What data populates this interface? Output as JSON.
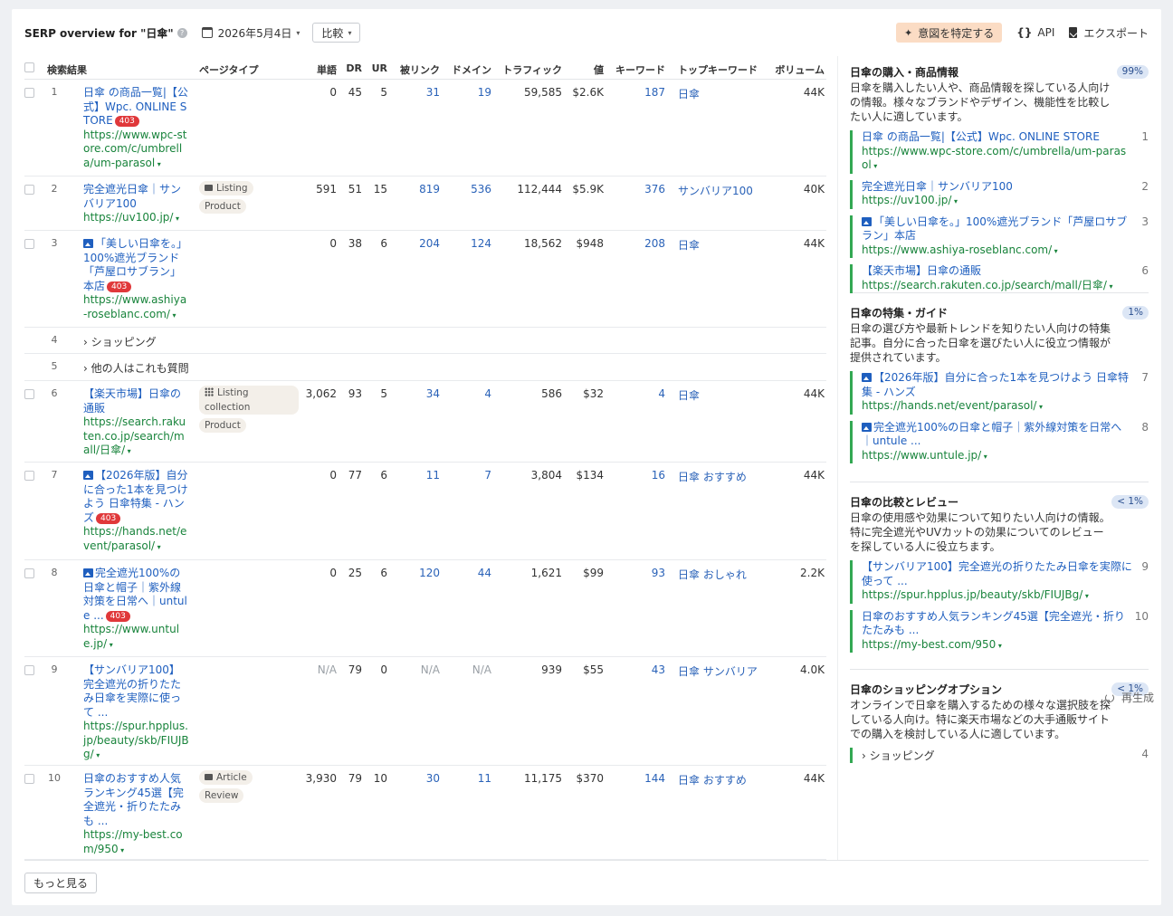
{
  "header": {
    "title": "SERP overview for \"日傘\"",
    "help": "?",
    "date": "2026年5月4日",
    "compare": "比較",
    "intent_button": "意図を特定する",
    "api": "API",
    "export": "エクスポート"
  },
  "columns": {
    "result": "検索結果",
    "page_type": "ページタイプ",
    "words": "単語",
    "dr": "DR",
    "ur": "UR",
    "backlinks": "被リンク",
    "domains": "ドメイン",
    "traffic": "トラフィック",
    "value": "値",
    "keywords": "キーワード",
    "top_keyword": "トップキーワード",
    "volume": "ボリューム"
  },
  "rows": [
    {
      "rank": "1",
      "title": "日傘 の商品一覧|【公式】Wpc. ONLINE STORE",
      "badge": "403",
      "img": false,
      "url": "https://www.wpc-store.com/c/umbrella/um-parasol",
      "tags": [],
      "words": "0",
      "dr": "45",
      "ur": "5",
      "backlinks": "31",
      "domains": "19",
      "traffic": "59,585",
      "value": "$2.6K",
      "keywords": "187",
      "top_keyword": "日傘",
      "volume": "44K"
    },
    {
      "rank": "2",
      "title": "完全遮光日傘｜サンバリア100",
      "badge": "",
      "img": false,
      "url": "https://uv100.jp/",
      "tags": [
        "Listing",
        "Product"
      ],
      "tag_icon": "label",
      "words": "591",
      "dr": "51",
      "ur": "15",
      "backlinks": "819",
      "domains": "536",
      "traffic": "112,444",
      "value": "$5.9K",
      "keywords": "376",
      "top_keyword": "サンバリア100",
      "volume": "40K"
    },
    {
      "rank": "3",
      "title": "「美しい日傘を。」100%遮光ブランド「芦屋ロサブラン」本店",
      "badge": "403",
      "img": true,
      "url": "https://www.ashiya-roseblanc.com/",
      "tags": [],
      "words": "0",
      "dr": "38",
      "ur": "6",
      "backlinks": "204",
      "domains": "124",
      "traffic": "18,562",
      "value": "$948",
      "keywords": "208",
      "top_keyword": "日傘",
      "volume": "44K"
    },
    {
      "rank": "4",
      "expand": "ショッピング"
    },
    {
      "rank": "5",
      "expand": "他の人はこれも質問"
    },
    {
      "rank": "6",
      "title": "【楽天市場】日傘の通販",
      "badge": "",
      "img": false,
      "url": "https://search.rakuten.co.jp/search/mall/日傘/",
      "tags": [
        "Listing collection",
        "Product"
      ],
      "tag_icon": "grid",
      "words": "3,062",
      "dr": "93",
      "ur": "5",
      "backlinks": "34",
      "domains": "4",
      "traffic": "586",
      "value": "$32",
      "keywords": "4",
      "top_keyword": "日傘",
      "volume": "44K"
    },
    {
      "rank": "7",
      "title": "【2026年版】自分に合った1本を見つけよう 日傘特集 - ハンズ",
      "badge": "403",
      "img": true,
      "url": "https://hands.net/event/parasol/",
      "tags": [],
      "words": "0",
      "dr": "77",
      "ur": "6",
      "backlinks": "11",
      "domains": "7",
      "traffic": "3,804",
      "value": "$134",
      "keywords": "16",
      "top_keyword": "日傘 おすすめ",
      "volume": "44K"
    },
    {
      "rank": "8",
      "title": "完全遮光100%の日傘と帽子｜紫外線対策を日常へ｜untule ...",
      "badge": "403",
      "img": true,
      "url": "https://www.untule.jp/",
      "tags": [],
      "words": "0",
      "dr": "25",
      "ur": "6",
      "backlinks": "120",
      "domains": "44",
      "traffic": "1,621",
      "value": "$99",
      "keywords": "93",
      "top_keyword": "日傘 おしゃれ",
      "volume": "2.2K"
    },
    {
      "rank": "9",
      "title": "【サンバリア100】完全遮光の折りたたみ日傘を実際に使って ...",
      "badge": "",
      "img": false,
      "url": "https://spur.hpplus.jp/beauty/skb/FIUJBg/",
      "tags": [],
      "words": "N/A",
      "dr": "79",
      "ur": "0",
      "backlinks": "N/A",
      "domains": "N/A",
      "traffic": "939",
      "value": "$55",
      "keywords": "43",
      "top_keyword": "日傘 サンバリア",
      "volume": "4.0K"
    },
    {
      "rank": "10",
      "title": "日傘のおすすめ人気ランキング45選【完全遮光・折りたたみも ...",
      "badge": "",
      "img": false,
      "url": "https://my-best.com/950",
      "tags": [
        "Article",
        "Review"
      ],
      "tag_icon": "article",
      "words": "3,930",
      "dr": "79",
      "ur": "10",
      "backlinks": "30",
      "domains": "11",
      "traffic": "11,175",
      "value": "$370",
      "keywords": "144",
      "top_keyword": "日傘 おすすめ",
      "volume": "44K"
    }
  ],
  "more_button": "もっと見る",
  "intents": [
    {
      "title": "日傘の購入・商品情報",
      "pct": "99%",
      "desc": "日傘を購入したい人や、商品情報を探している人向けの情報。様々なブランドやデザイン、機能性を比較したい人に適しています。",
      "items": [
        {
          "title": "日傘 の商品一覧|【公式】Wpc. ONLINE STORE",
          "url": "https://www.wpc-store.com/c/umbrella/um-parasol",
          "pos": "1",
          "img": false
        },
        {
          "title": "完全遮光日傘｜サンバリア100",
          "url": "https://uv100.jp/",
          "pos": "2",
          "img": false
        },
        {
          "title": "「美しい日傘を。」100%遮光ブランド「芦屋ロサブラン」本店",
          "url": "https://www.ashiya-roseblanc.com/",
          "pos": "3",
          "img": true
        },
        {
          "title": "【楽天市場】日傘の通販",
          "url": "https://search.rakuten.co.jp/search/mall/日傘/",
          "pos": "6",
          "img": false
        }
      ]
    },
    {
      "title": "日傘の特集・ガイド",
      "pct": "1%",
      "desc": "日傘の選び方や最新トレンドを知りたい人向けの特集記事。自分に合った日傘を選びたい人に役立つ情報が提供されています。",
      "items": [
        {
          "title": "【2026年版】自分に合った1本を見つけよう 日傘特集 - ハンズ",
          "url": "https://hands.net/event/parasol/",
          "pos": "7",
          "img": true
        },
        {
          "title": "完全遮光100%の日傘と帽子｜紫外線対策を日常へ｜untule ...",
          "url": "https://www.untule.jp/",
          "pos": "8",
          "img": true
        }
      ]
    },
    {
      "title": "日傘の比較とレビュー",
      "pct": "< 1%",
      "desc": "日傘の使用感や効果について知りたい人向けの情報。特に完全遮光やUVカットの効果についてのレビューを探している人に役立ちます。",
      "items": [
        {
          "title": "【サンバリア100】完全遮光の折りたたみ日傘を実際に使って ...",
          "url": "https://spur.hpplus.jp/beauty/skb/FIUJBg/",
          "pos": "9",
          "img": false
        },
        {
          "title": "日傘のおすすめ人気ランキング45選【完全遮光・折りたたみも ...",
          "url": "https://my-best.com/950",
          "pos": "10",
          "img": false
        }
      ]
    },
    {
      "title": "日傘のショッピングオプション",
      "pct": "< 1%",
      "desc": "オンラインで日傘を購入するための様々な選択肢を探している人向け。特に楽天市場などの大手通販サイトでの購入を検討している人に適しています。",
      "items": [
        {
          "expand": "ショッピング",
          "pos": "4"
        }
      ]
    }
  ],
  "regenerate": "再生成",
  "colors": {
    "link": "#1f5fbf",
    "url": "#19843c",
    "badge": "#e0383a",
    "intent_bar": "#33a853",
    "intent_button": "#fbdcc4"
  }
}
